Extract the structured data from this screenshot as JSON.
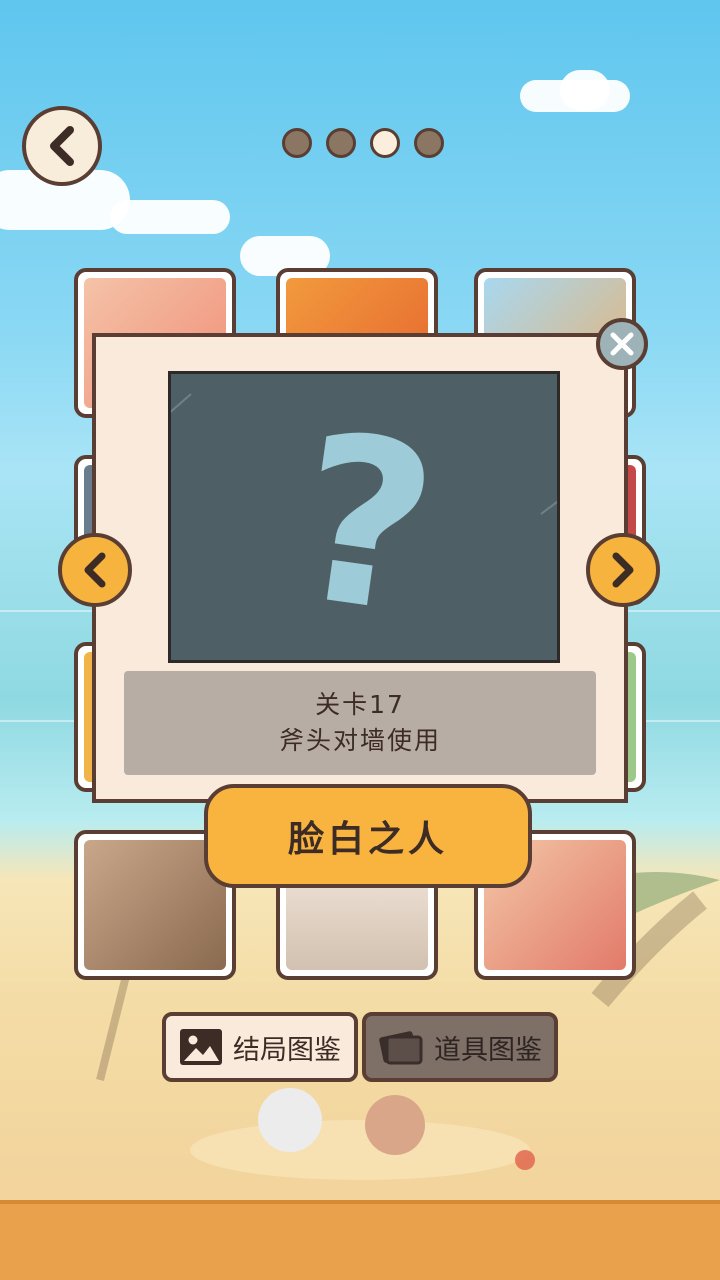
{
  "pager": {
    "count": 4,
    "active_index": 2
  },
  "modal": {
    "image_state": "locked",
    "placeholder_glyph": "?",
    "level_label": "关卡17",
    "hint_text": "斧头对墙使用",
    "ending_title": "脸白之人"
  },
  "bottom_tabs": [
    {
      "label": "结局图鉴",
      "icon": "image-icon",
      "selected": true
    },
    {
      "label": "道具图鉴",
      "icon": "cards-icon",
      "selected": false
    }
  ],
  "colors": {
    "accent": "#f6b43e",
    "outline": "#5a3e33",
    "panel": "#f9eadc"
  }
}
